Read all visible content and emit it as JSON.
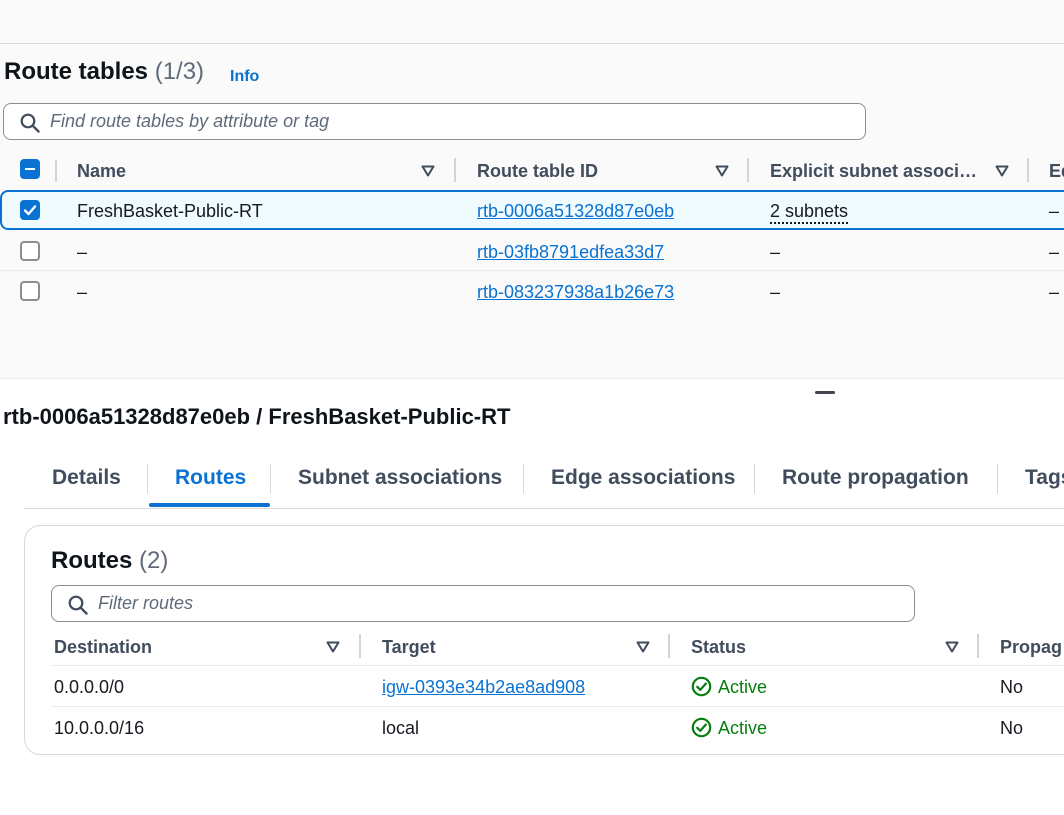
{
  "route_tables": {
    "title": "Route tables",
    "count": "(1/3)",
    "info_label": "Info",
    "search_placeholder": "Find route tables by attribute or tag",
    "columns": [
      "Name",
      "Route table ID",
      "Explicit subnet associ…",
      "Ed"
    ],
    "rows": [
      {
        "name": "FreshBasket-Public-RT",
        "id": "rtb-0006a51328d87e0eb",
        "subnets": "2 subnets",
        "edge": "–",
        "selected": true
      },
      {
        "name": "–",
        "id": "rtb-03fb8791edfea33d7",
        "subnets": "–",
        "edge": "–",
        "selected": false
      },
      {
        "name": "–",
        "id": "rtb-083237938a1b26e73",
        "subnets": "–",
        "edge": "–",
        "selected": false
      }
    ]
  },
  "detail": {
    "title": "rtb-0006a51328d87e0eb / FreshBasket-Public-RT",
    "tabs": [
      "Details",
      "Routes",
      "Subnet associations",
      "Edge associations",
      "Route propagation",
      "Tags"
    ],
    "active_tab": "Routes"
  },
  "routes": {
    "title": "Routes",
    "count": "(2)",
    "filter_placeholder": "Filter routes",
    "columns": [
      "Destination",
      "Target",
      "Status",
      "Propag"
    ],
    "rows": [
      {
        "destination": "0.0.0.0/0",
        "target": "igw-0393e34b2ae8ad908",
        "target_is_link": true,
        "status": "Active",
        "propagated": "No"
      },
      {
        "destination": "10.0.0.0/16",
        "target": "local",
        "target_is_link": false,
        "status": "Active",
        "propagated": "No"
      }
    ]
  },
  "icons": {
    "search": "search-icon",
    "sort": "sort-caret-icon",
    "status_ok": "check-circle-icon"
  },
  "colors": {
    "accent": "#0972d3",
    "success": "#037f0c",
    "text": "#16191f"
  }
}
